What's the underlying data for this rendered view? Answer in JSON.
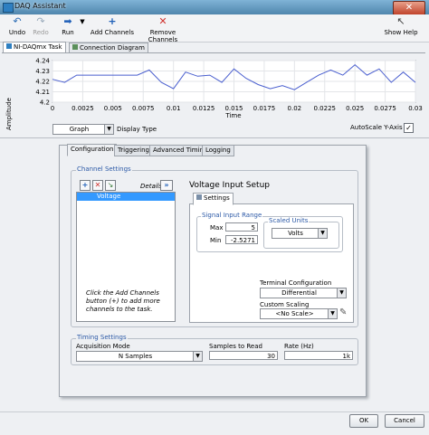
{
  "window": {
    "title": "DAQ Assistant",
    "close": "✕"
  },
  "toolbar": {
    "undo": "Undo",
    "redo": "Redo",
    "run": "Run",
    "add_channels": "Add Channels",
    "remove_channels": "Remove Channels",
    "show_help": "Show Help"
  },
  "view_tabs": [
    "NI-DAQmx Task",
    "Connection Diagram"
  ],
  "graph": {
    "ylabel": "Amplitude",
    "xlabel": "Time",
    "display_type_value": "Graph",
    "display_type_label": "Display Type",
    "autoscale_label": "AutoScale Y-Axis",
    "autoscale_checked": true
  },
  "chart_data": {
    "type": "line",
    "xlabel": "Time",
    "ylabel": "Amplitude",
    "xlim": [
      0,
      0.03
    ],
    "ylim": [
      4.2,
      4.24
    ],
    "x_ticks": [
      "0",
      "0.0025",
      "0.005",
      "0.0075",
      "0.01",
      "0.0125",
      "0.015",
      "0.0175",
      "0.02",
      "0.0225",
      "0.025",
      "0.0275",
      "0.03"
    ],
    "y_ticks": [
      "4.2",
      "4.21",
      "4.22",
      "4.23",
      "4.24"
    ],
    "color": "#4a5fcf",
    "x": [
      0,
      0.001,
      0.002,
      0.003,
      0.004,
      0.005,
      0.006,
      0.007,
      0.008,
      0.009,
      0.01,
      0.011,
      0.012,
      0.013,
      0.014,
      0.015,
      0.016,
      0.017,
      0.018,
      0.019,
      0.02,
      0.021,
      0.022,
      0.023,
      0.024,
      0.025,
      0.026,
      0.027,
      0.028,
      0.029,
      0.03
    ],
    "values": [
      4.222,
      4.219,
      4.226,
      4.226,
      4.226,
      4.226,
      4.226,
      4.226,
      4.231,
      4.219,
      4.213,
      4.229,
      4.225,
      4.226,
      4.219,
      4.232,
      4.223,
      4.217,
      4.213,
      4.216,
      4.212,
      4.219,
      4.226,
      4.231,
      4.226,
      4.236,
      4.226,
      4.232,
      4.219,
      4.229,
      4.219
    ]
  },
  "config_tabs": [
    "Configuration",
    "Triggering",
    "Advanced Timing",
    "Logging"
  ],
  "channel_settings": {
    "title": "Channel Settings",
    "details_label": "Details",
    "items": [
      "Voltage"
    ],
    "hint": "Click the Add Channels button (+) to add more channels to the task."
  },
  "voltage_setup": {
    "title": "Voltage Input Setup",
    "settings_tab": "Settings",
    "signal_input_range": "Signal Input Range",
    "max_label": "Max",
    "max_value": "5",
    "min_label": "Min",
    "min_value": "-2.5271",
    "scaled_units_label": "Scaled Units",
    "scaled_units_value": "Volts",
    "terminal_config_label": "Terminal Configuration",
    "terminal_config_value": "Differential",
    "custom_scaling_label": "Custom Scaling",
    "custom_scaling_value": "<No Scale>"
  },
  "timing": {
    "title": "Timing Settings",
    "acq_mode_label": "Acquisition Mode",
    "acq_mode_value": "N Samples",
    "samples_label": "Samples to Read",
    "samples_value": "30",
    "rate_label": "Rate (Hz)",
    "rate_value": "1k"
  },
  "footer": {
    "ok": "OK",
    "cancel": "Cancel"
  }
}
